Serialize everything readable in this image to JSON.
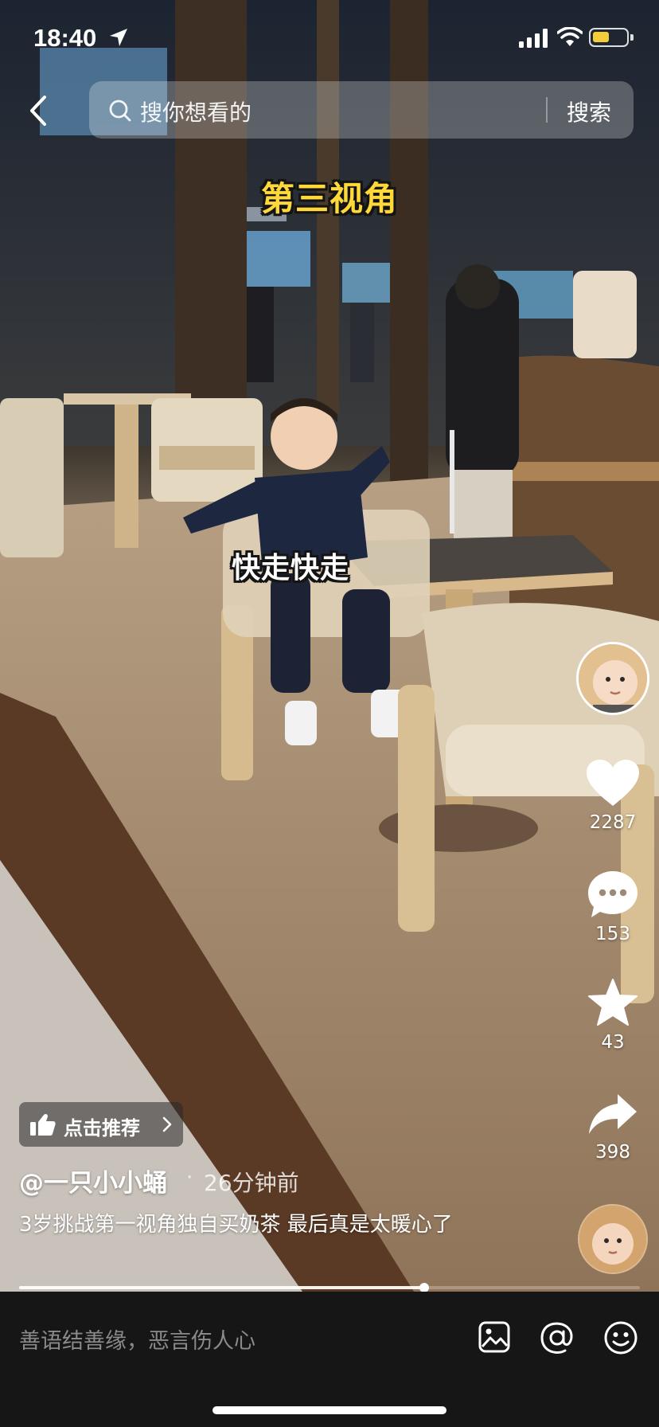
{
  "status_bar": {
    "time": "18:40",
    "battery_level": 0.5
  },
  "search": {
    "placeholder": "搜你想看的",
    "button_label": "搜索"
  },
  "video": {
    "caption_top": "第三视角",
    "caption_middle": "快走快走"
  },
  "actions": {
    "likes": "2287",
    "comments": "153",
    "favorites": "43",
    "shares": "398"
  },
  "post": {
    "recommend_label": "点击推荐",
    "author": "@一只小小蛹",
    "separator": "·",
    "time_ago": "26分钟前",
    "description": "3岁挑战第一视角独自买奶茶 最后真是太暖心了"
  },
  "playback": {
    "progress": 0.652
  },
  "comment_bar": {
    "placeholder": "善语结善缘，恶言伤人心",
    "icons": [
      "image-icon",
      "mention-icon",
      "emoji-icon"
    ]
  },
  "colors": {
    "caption_yellow": "#ffd83a",
    "battery_yellow": "#f3cd3a",
    "comment_bar_bg": "#161616"
  }
}
